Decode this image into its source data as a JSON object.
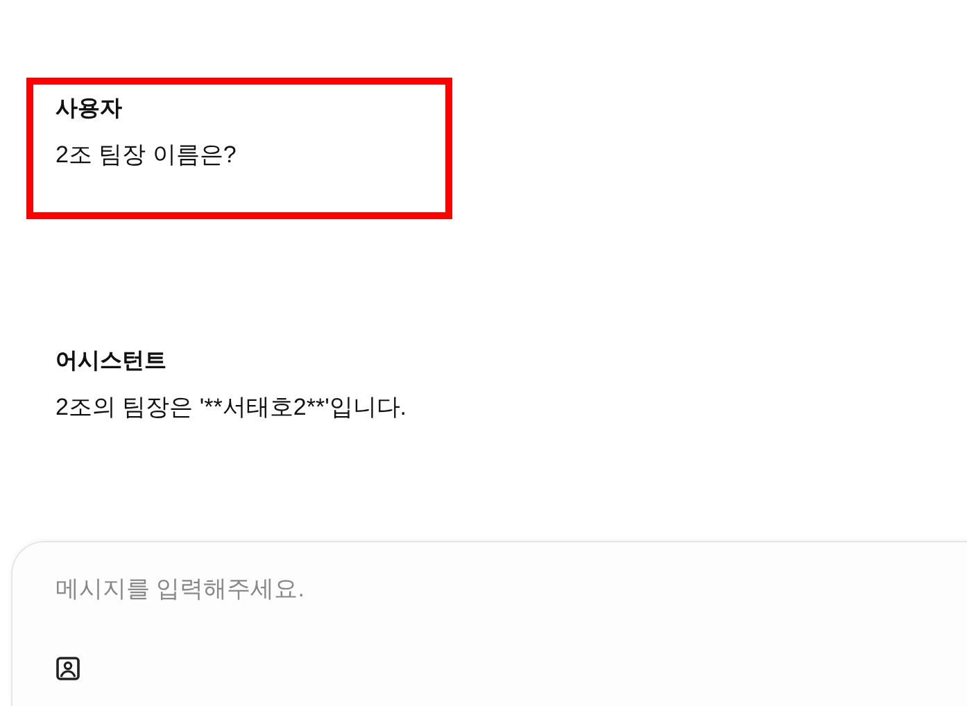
{
  "messages": [
    {
      "highlighted": true,
      "sender": "사용자",
      "text": "2조 팀장 이름은?"
    },
    {
      "highlighted": false,
      "sender": "어시스턴트",
      "text": "2조의 팀장은 '**서태호2**'입니다."
    }
  ],
  "composer": {
    "placeholder": "메시지를 입력해주세요."
  }
}
